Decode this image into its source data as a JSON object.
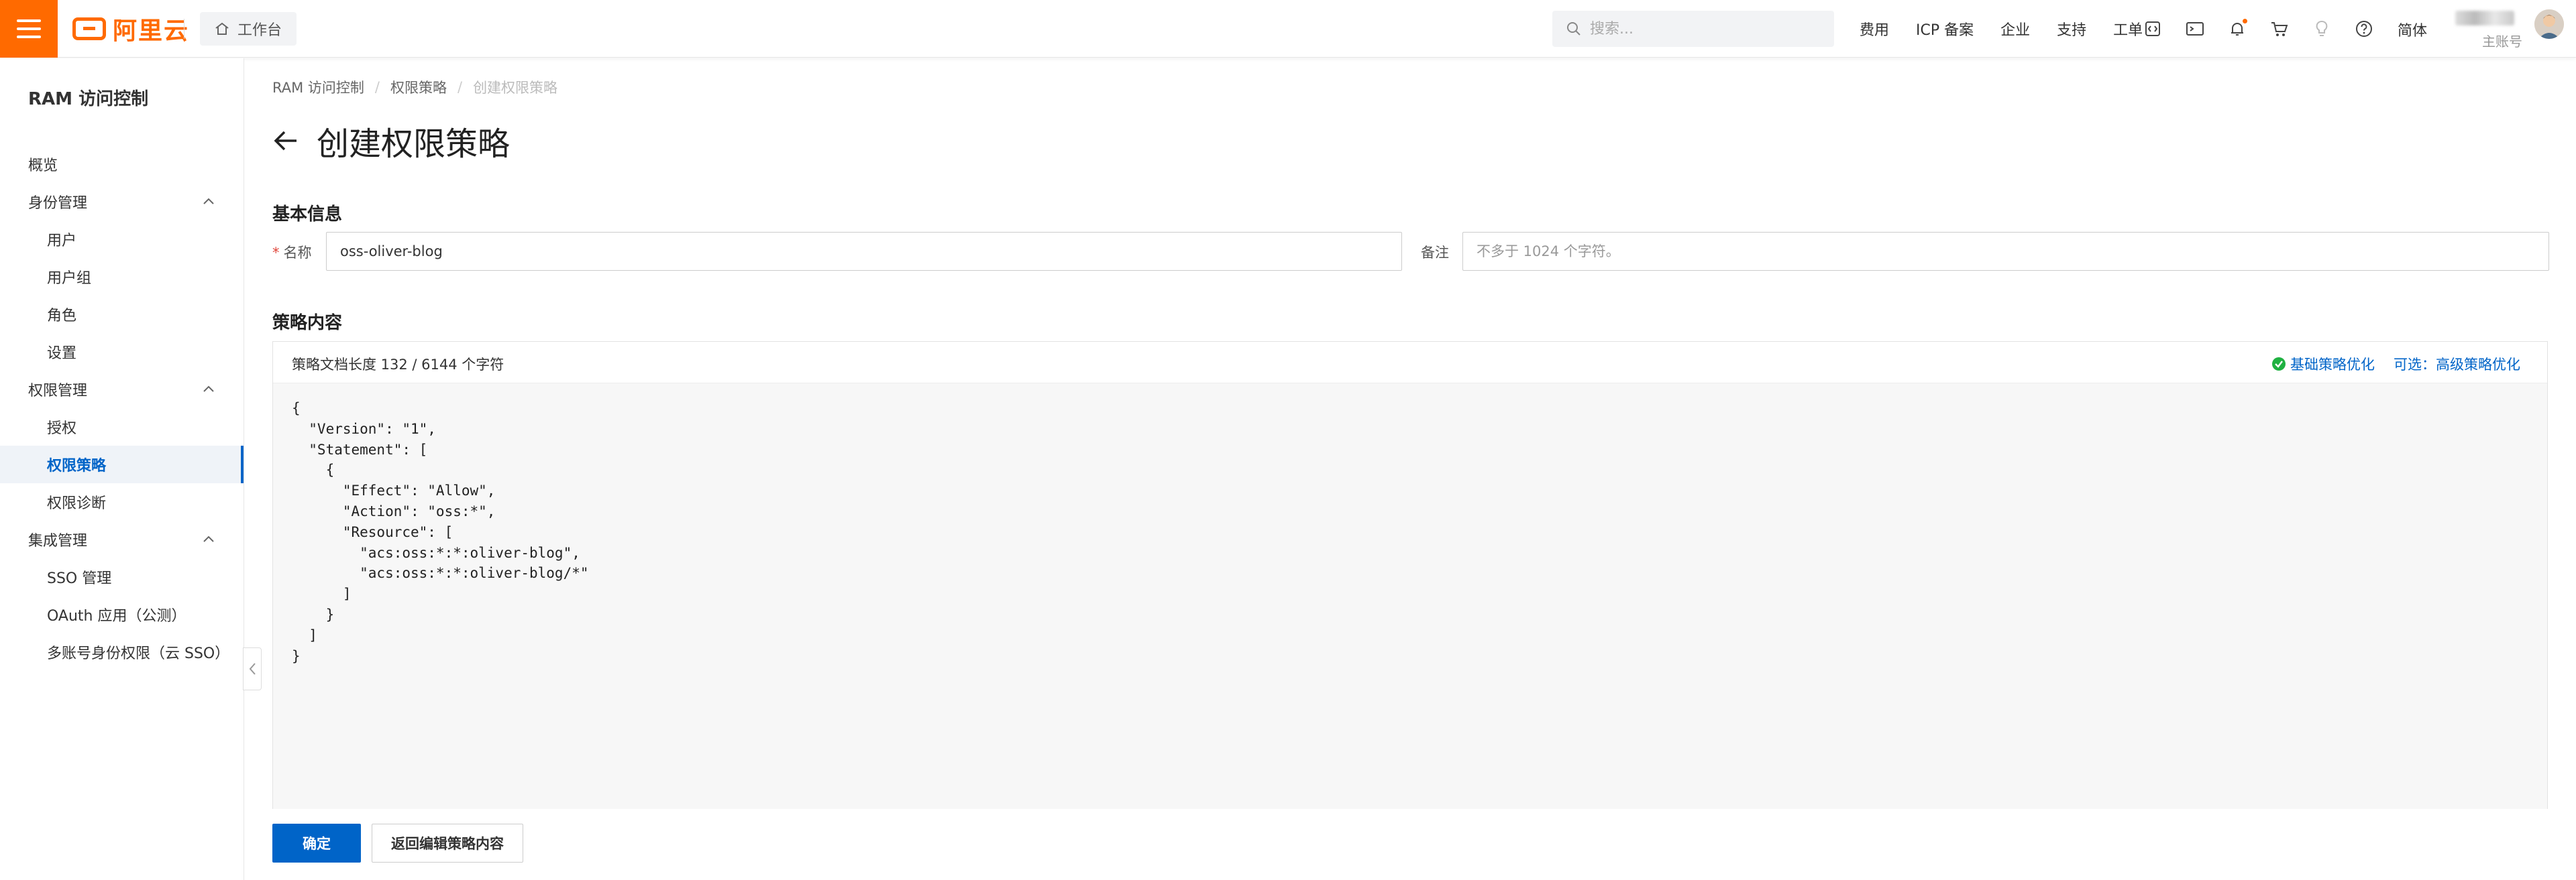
{
  "topbar": {
    "logo_text": "阿里云",
    "workbench_label": "工作台",
    "search_placeholder": "搜索...",
    "links": [
      "费用",
      "ICP 备案",
      "企业",
      "支持",
      "工单"
    ],
    "icons": [
      "code-icon",
      "terminal-icon",
      "bell-icon",
      "cart-icon",
      "lightbulb-icon",
      "help-icon"
    ],
    "language": "简体",
    "account_label": "主账号",
    "accent_color": "#ff6a00"
  },
  "sidebar": {
    "title": "RAM 访问控制",
    "items": [
      {
        "label": "概览",
        "level": 1
      },
      {
        "label": "身份管理",
        "level": 1,
        "expanded": true
      },
      {
        "label": "用户",
        "level": 2
      },
      {
        "label": "用户组",
        "level": 2
      },
      {
        "label": "角色",
        "level": 2
      },
      {
        "label": "设置",
        "level": 2
      },
      {
        "label": "权限管理",
        "level": 1,
        "expanded": true
      },
      {
        "label": "授权",
        "level": 2
      },
      {
        "label": "权限策略",
        "level": 2,
        "active": true
      },
      {
        "label": "权限诊断",
        "level": 2
      },
      {
        "label": "集成管理",
        "level": 1,
        "expanded": true
      },
      {
        "label": "SSO 管理",
        "level": 2
      },
      {
        "label": "OAuth 应用（公测）",
        "level": 2
      },
      {
        "label": "多账号身份权限（云 SSO）",
        "level": 2
      }
    ]
  },
  "breadcrumb": [
    "RAM 访问控制",
    "权限策略",
    "创建权限策略"
  ],
  "page_title": "创建权限策略",
  "basic_info": {
    "section_title": "基本信息",
    "name_label": "名称",
    "name_value": "oss-oliver-blog",
    "remark_label": "备注",
    "remark_placeholder": "不多于 1024 个字符。"
  },
  "policy": {
    "section_title": "策略内容",
    "doc_length": "策略文档长度 132 / 6144 个字符",
    "basic_optimize": "基础策略优化",
    "advanced_optimize": "可选：高级策略优化",
    "code": "{\n  \"Version\": \"1\",\n  \"Statement\": [\n    {\n      \"Effect\": \"Allow\",\n      \"Action\": \"oss:*\",\n      \"Resource\": [\n        \"acs:oss:*:*:oliver-blog\",\n        \"acs:oss:*:*:oliver-blog/*\"\n      ]\n    }\n  ]\n}"
  },
  "buttons": {
    "confirm": "确定",
    "back_edit": "返回编辑策略内容"
  },
  "colors": {
    "primary": "#0064c8",
    "success": "#1fb141"
  }
}
